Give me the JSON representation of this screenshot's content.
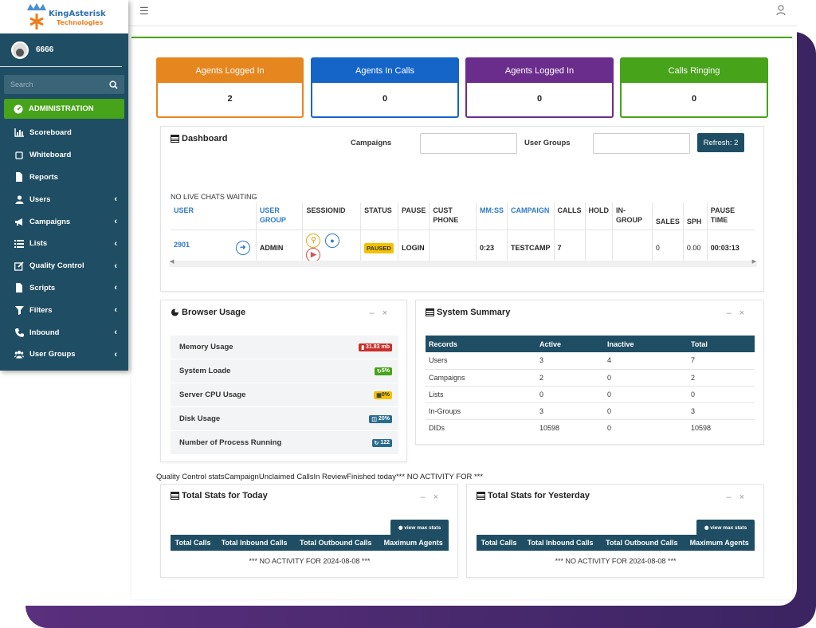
{
  "brand": {
    "name": "KingAsterisk",
    "sub": "Technologies"
  },
  "user": {
    "name": "6666"
  },
  "search": {
    "placeholder": "Search"
  },
  "nav": {
    "active": "ADMINISTRATION",
    "items": [
      {
        "label": "Scoreboard",
        "icon": "bar-chart-icon",
        "has_children": false
      },
      {
        "label": "Whiteboard",
        "icon": "square-icon",
        "has_children": false
      },
      {
        "label": "Reports",
        "icon": "file-icon",
        "has_children": false
      },
      {
        "label": "Users",
        "icon": "user-icon",
        "has_children": true
      },
      {
        "label": "Campaigns",
        "icon": "bullhorn-icon",
        "has_children": true
      },
      {
        "label": "Lists",
        "icon": "list-icon",
        "has_children": true
      },
      {
        "label": "Quality Control",
        "icon": "edit-icon",
        "has_children": true
      },
      {
        "label": "Scripts",
        "icon": "file-icon",
        "has_children": true
      },
      {
        "label": "Filters",
        "icon": "filter-icon",
        "has_children": true
      },
      {
        "label": "Inbound",
        "icon": "phone-icon",
        "has_children": true
      },
      {
        "label": "User Groups",
        "icon": "users-icon",
        "has_children": true
      }
    ]
  },
  "stats": [
    {
      "label": "Agents Logged In",
      "value": "2",
      "color": "#e5861f"
    },
    {
      "label": "Agents In Calls",
      "value": "0",
      "color": "#1565c8"
    },
    {
      "label": "Agents Logged In",
      "value": "0",
      "color": "#6b2d8c"
    },
    {
      "label": "Calls Ringing",
      "value": "0",
      "color": "#47a319"
    }
  ],
  "dashboard": {
    "title": "Dashboard",
    "campaigns_label": "Campaigns",
    "user_groups_label": "User Groups",
    "refresh_label": "Refresh: 2",
    "no_live_chats": "NO LIVE CHATS WAITING",
    "columns": [
      "USER",
      "USER GROUP",
      "SESSIONID",
      "STATUS",
      "PAUSE",
      "CUST PHONE",
      "MM:SS",
      "CAMPAIGN",
      "CALLS",
      "HOLD",
      "IN-GROUP",
      "SALES",
      "SPH",
      "PAUSE TIME"
    ],
    "rows": [
      {
        "user": "2901",
        "user_group": "ADMIN",
        "status": "PAUSED",
        "pause": "LOGIN",
        "cust_phone": "",
        "mmss": "0:23",
        "campaign": "TESTCAMP",
        "calls": "7",
        "hold": "",
        "in_group": "",
        "sales": "0",
        "sph": "0.00",
        "pause_time": "00:03:13"
      }
    ]
  },
  "browser_usage": {
    "title": "Browser Usage",
    "rows": [
      {
        "label": "Memory Usage",
        "badge": "31.83 mb",
        "color": "#c9302c"
      },
      {
        "label": "System Loade",
        "badge": "5%",
        "color": "#47a319"
      },
      {
        "label": "Server CPU Usage",
        "badge": "0%",
        "color": "#f2c200"
      },
      {
        "label": "Disk Usage",
        "badge": "20%",
        "color": "#2a6b8f"
      },
      {
        "label": "Number of Process Running",
        "badge": "122",
        "color": "#2a6b8f"
      }
    ]
  },
  "system_summary": {
    "title": "System Summary",
    "columns": [
      "Records",
      "Active",
      "Inactive",
      "Total"
    ],
    "rows": [
      [
        "Users",
        "3",
        "4",
        "7"
      ],
      [
        "Campaigns",
        "2",
        "0",
        "2"
      ],
      [
        "Lists",
        "0",
        "0",
        "0"
      ],
      [
        "In-Groups",
        "3",
        "0",
        "3"
      ],
      [
        "DIDs",
        "10598",
        "0",
        "10598"
      ]
    ]
  },
  "qc_line": "Quality Control statsCampaignUnclaimed CallsIn ReviewFinished today*** NO ACTIVITY FOR  ***",
  "today": {
    "title": "Total Stats for Today",
    "button": "view max stats",
    "columns": [
      "Total Calls",
      "Total Inbound Calls",
      "Total Outbound Calls",
      "Maximum Agents"
    ],
    "no_activity": "*** NO ACTIVITY FOR  2024-08-08 ***"
  },
  "yesterday": {
    "title": "Total Stats for Yesterday",
    "button": "view max stats",
    "columns": [
      "Total Calls",
      "Total Inbound Calls",
      "Total Outbound Calls",
      "Maximum Agents"
    ],
    "no_activity": "*** NO ACTIVITY FOR  2024-08-08 ***"
  }
}
